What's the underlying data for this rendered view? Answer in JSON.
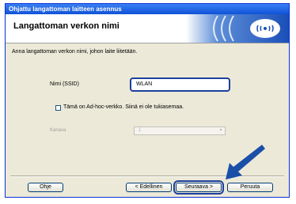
{
  "window": {
    "title": "Ohjattu langattoman laitteen asennus",
    "header_title": "Langattoman verkon nimi"
  },
  "main": {
    "instruction": "Anna langattoman verkon nimi, johon laite liitetään.",
    "ssid_label": "Nimi (SSID)",
    "ssid_value": "WLAN",
    "adhoc_label": "Tämä on Ad-hoc-verkko. Siinä ei ole tukiasemaa.",
    "channel_label": "Kanava",
    "channel_value": "1"
  },
  "buttons": {
    "help": "Ohje",
    "back": "< Edellinen",
    "next": "Seuraava >",
    "cancel": "Peruuta"
  },
  "colors": {
    "title_bar": "#1a5ce0",
    "highlight": "#1c3f9e",
    "arrow": "#1a4fa8"
  },
  "icons": {
    "banner": "wireless-signal-icon",
    "pointer": "arrow-pointer-icon"
  }
}
